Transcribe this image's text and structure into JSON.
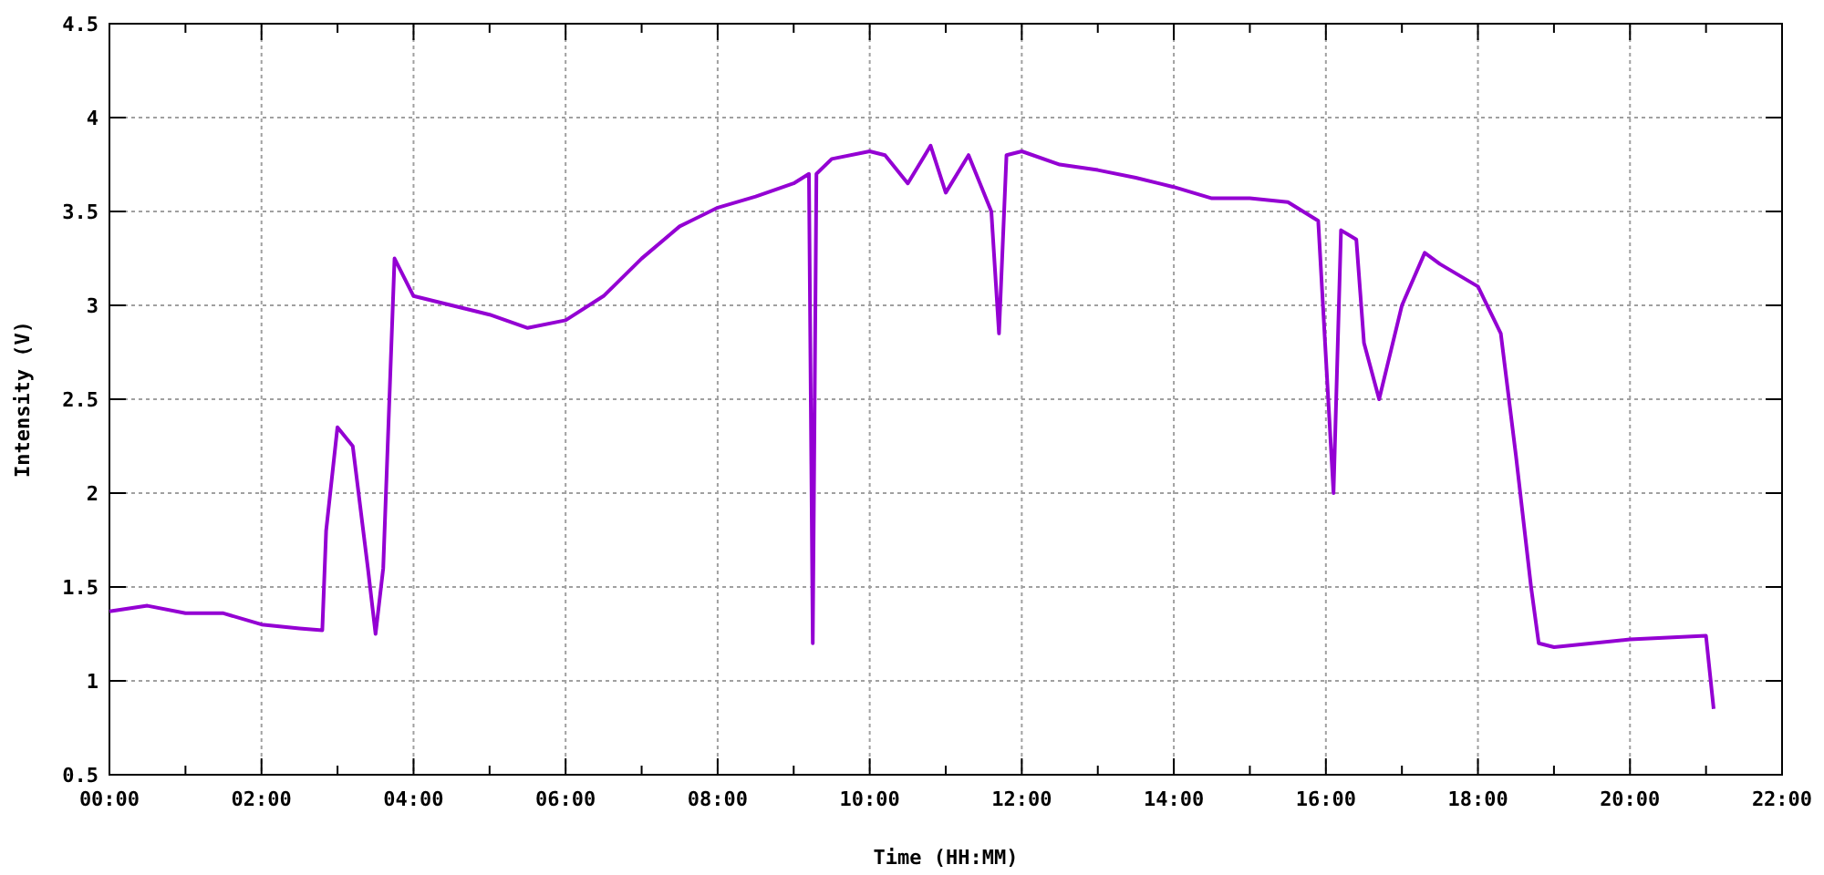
{
  "chart": {
    "chart_data": {
      "type": "line",
      "xlabel": "Time (HH:MM)",
      "ylabel": "Intensity (V)",
      "x": [
        0,
        0.5,
        1,
        1.5,
        2,
        2.5,
        2.8,
        2.85,
        3.0,
        3.2,
        3.4,
        3.5,
        3.6,
        3.75,
        4,
        4.5,
        5,
        5.5,
        6,
        6.5,
        7,
        7.5,
        8,
        8.5,
        9,
        9.2,
        9.25,
        9.3,
        9.5,
        10,
        10.2,
        10.5,
        10.8,
        11,
        11.3,
        11.6,
        11.7,
        11.8,
        12,
        12.5,
        13,
        13.5,
        14,
        14.5,
        15,
        15.5,
        15.9,
        16.1,
        16.2,
        16.4,
        16.5,
        16.7,
        17,
        17.3,
        17.5,
        18,
        18.3,
        18.5,
        18.7,
        18.8,
        19,
        19.5,
        20,
        20.5,
        21,
        21.1
      ],
      "series": [
        {
          "color": "#9400d3",
          "values": [
            1.37,
            1.4,
            1.36,
            1.36,
            1.3,
            1.28,
            1.27,
            1.8,
            2.35,
            2.25,
            1.6,
            1.25,
            1.6,
            3.25,
            3.05,
            3.0,
            2.95,
            2.88,
            2.92,
            3.05,
            3.25,
            3.42,
            3.52,
            3.58,
            3.65,
            3.7,
            1.2,
            3.7,
            3.78,
            3.82,
            3.8,
            3.65,
            3.85,
            3.6,
            3.8,
            3.5,
            2.85,
            3.8,
            3.82,
            3.75,
            3.72,
            3.68,
            3.63,
            3.57,
            3.57,
            3.55,
            3.45,
            2.0,
            3.4,
            3.35,
            2.8,
            2.5,
            3.0,
            3.28,
            3.22,
            3.1,
            2.85,
            2.2,
            1.5,
            1.2,
            1.18,
            1.2,
            1.22,
            1.23,
            1.24,
            0.85
          ]
        }
      ],
      "grid": true,
      "xlim": [
        0,
        22
      ],
      "ylim": [
        0.5,
        4.5
      ],
      "xticks": [
        {
          "value": 0,
          "label": "00:00"
        },
        {
          "value": 2,
          "label": "02:00"
        },
        {
          "value": 4,
          "label": "04:00"
        },
        {
          "value": 6,
          "label": "06:00"
        },
        {
          "value": 8,
          "label": "08:00"
        },
        {
          "value": 10,
          "label": "10:00"
        },
        {
          "value": 12,
          "label": "12:00"
        },
        {
          "value": 14,
          "label": "14:00"
        },
        {
          "value": 16,
          "label": "16:00"
        },
        {
          "value": 18,
          "label": "18:00"
        },
        {
          "value": 20,
          "label": "20:00"
        },
        {
          "value": 22,
          "label": "22:00"
        }
      ],
      "yticks": [
        0.5,
        1,
        1.5,
        2,
        2.5,
        3,
        3.5,
        4,
        4.5
      ]
    }
  }
}
